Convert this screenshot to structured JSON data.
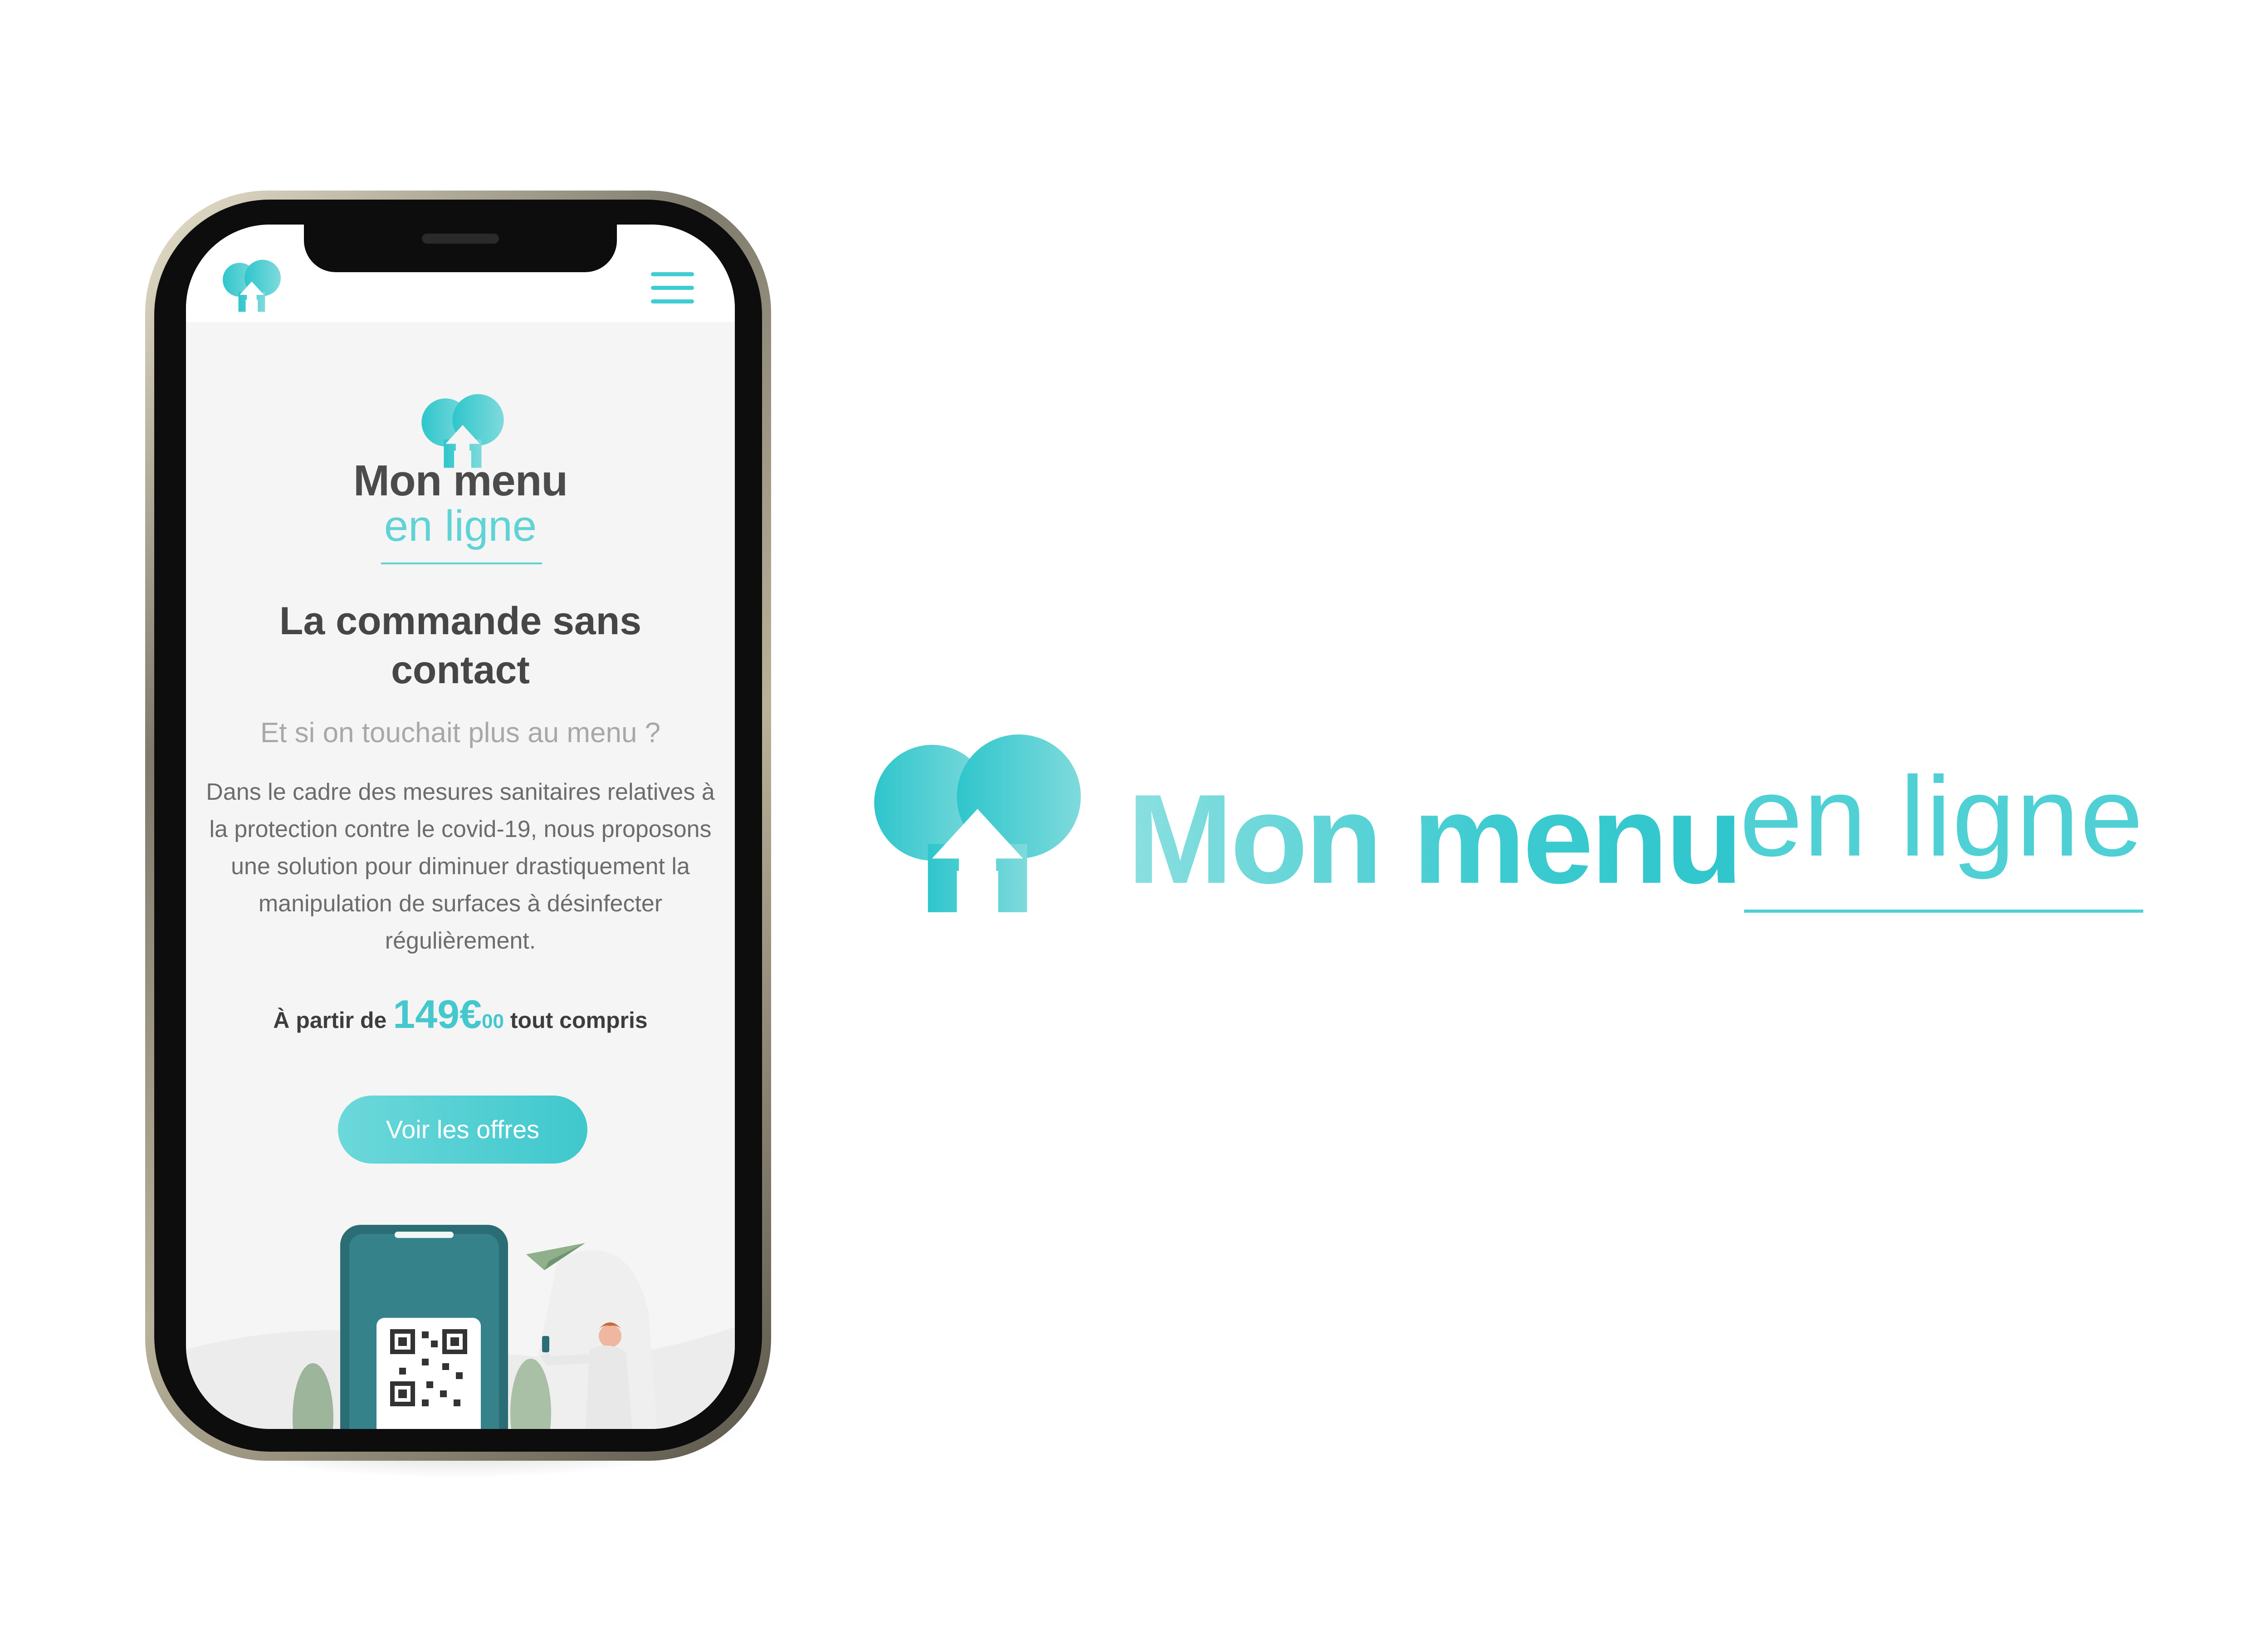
{
  "nav": {
    "menu_icon": "hamburger-icon",
    "logo_icon": "chef-hat-logo-icon"
  },
  "hero": {
    "brand_line1": "Mon menu",
    "brand_line2": "en ligne",
    "headline": "La commande sans contact",
    "subtitle": "Et si on touchait plus au menu ?",
    "description": "Dans le cadre des mesures sanitaires relatives à la protection contre le covid-19, nous proposons une solution pour diminuer drastiquement la manipulation de surfaces à désinfecter régulièrement.",
    "price_prefix": "À partir de",
    "price_amount": "149€",
    "price_cents": "00",
    "price_suffix": "tout compris",
    "cta_label": "Voir les offres"
  },
  "brand": {
    "name": "Mon menu",
    "tagline": "en ligne"
  },
  "colors": {
    "accent": "#3fcdd1",
    "text_dark": "#464646",
    "text_muted": "#a8a8a8"
  }
}
